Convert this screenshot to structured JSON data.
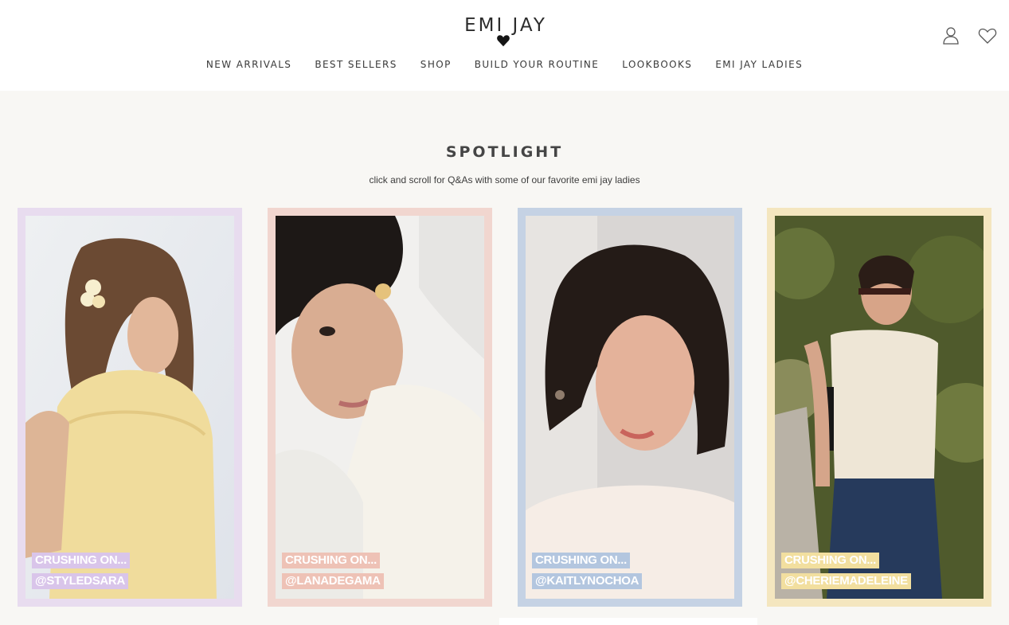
{
  "brand": {
    "logo_text": "EMI JAY"
  },
  "nav": {
    "items": [
      "NEW ARRIVALS",
      "BEST SELLERS",
      "SHOP",
      "BUILD YOUR ROUTINE",
      "LOOKBOOKS",
      "EMI JAY LADIES"
    ]
  },
  "header_icons": [
    "account-icon",
    "wishlist-heart-icon"
  ],
  "spotlight": {
    "title": "SPOTLIGHT",
    "subtitle": "click and scroll for Q&As with some of our favorite emi jay ladies"
  },
  "cards": [
    {
      "line1": "CRUSHING ON...",
      "line2": "@STYLEDSARA",
      "frame_color": "#e8dcef",
      "tag_color": "#d9c5ea"
    },
    {
      "line1": "CRUSHING ON...",
      "line2": "@LANADEGAMA",
      "frame_color": "#f1d6cf",
      "tag_color": "#eec2b6"
    },
    {
      "line1": "CRUSHING ON...",
      "line2": "@KAITLYNOCHOA",
      "frame_color": "#c5d2e4",
      "tag_color": "#b3c6df"
    },
    {
      "line1": "CRUSHING ON...",
      "line2": "@CHERIEMADELEINE",
      "frame_color": "#f4e6bf",
      "tag_color": "#f2df9f"
    }
  ]
}
